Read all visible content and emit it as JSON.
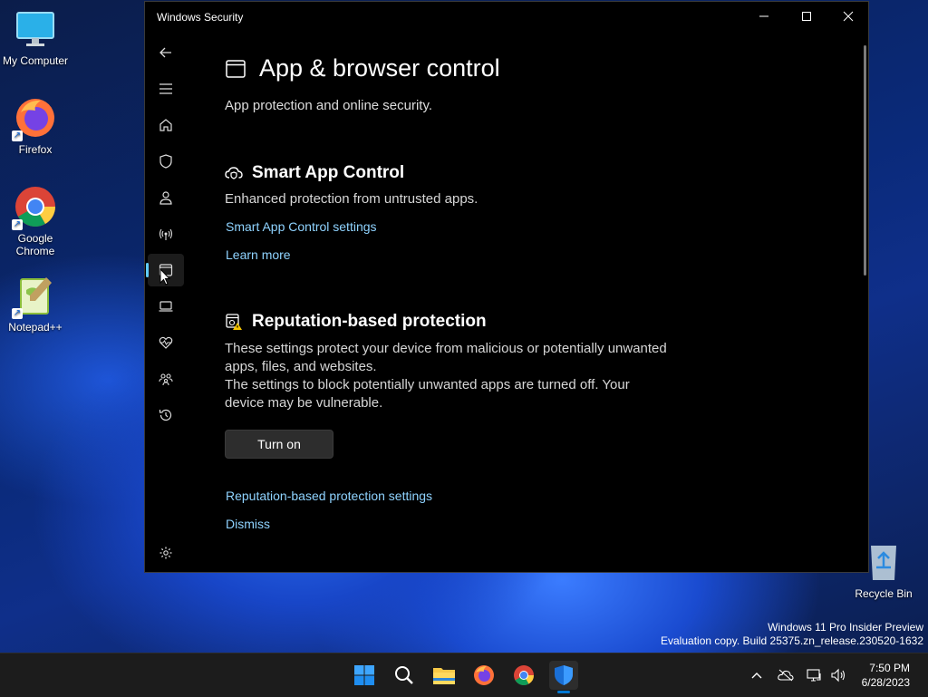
{
  "desktop": {
    "icons": [
      {
        "label": "My Computer"
      },
      {
        "label": "Firefox"
      },
      {
        "label": "Google Chrome"
      },
      {
        "label": "Notepad++"
      },
      {
        "label": "Recycle Bin"
      }
    ],
    "watermark": {
      "line1": "Windows 11 Pro Insider Preview",
      "line2": "Evaluation copy. Build 25375.zn_release.230520-1632"
    }
  },
  "window": {
    "title": "Windows Security",
    "nav": [
      {
        "icon": "back-arrow-icon"
      },
      {
        "icon": "hamburger-menu-icon"
      },
      {
        "icon": "home-icon"
      },
      {
        "icon": "shield-icon"
      },
      {
        "icon": "person-icon"
      },
      {
        "icon": "wireless-icon"
      },
      {
        "icon": "app-browser-icon",
        "active": true
      },
      {
        "icon": "laptop-icon"
      },
      {
        "icon": "heart-pulse-icon"
      },
      {
        "icon": "family-icon"
      },
      {
        "icon": "history-icon"
      },
      {
        "icon": "settings-gear-icon"
      }
    ],
    "page": {
      "title": "App & browser control",
      "subtitle": "App protection and online security.",
      "smart_app": {
        "heading": "Smart App Control",
        "description": "Enhanced protection from untrusted apps.",
        "settings_link": "Smart App Control settings",
        "learn_more": "Learn more"
      },
      "reputation": {
        "heading": "Reputation-based protection",
        "description1": "These settings protect your device from malicious or potentially unwanted apps, files, and websites.",
        "description2": "The settings to block potentially unwanted apps are turned off. Your device may be vulnerable.",
        "button": "Turn on",
        "settings_link": "Reputation-based protection settings",
        "dismiss": "Dismiss"
      }
    }
  },
  "taskbar": {
    "time": "7:50 PM",
    "date": "6/28/2023",
    "accent": "#0078d4"
  }
}
